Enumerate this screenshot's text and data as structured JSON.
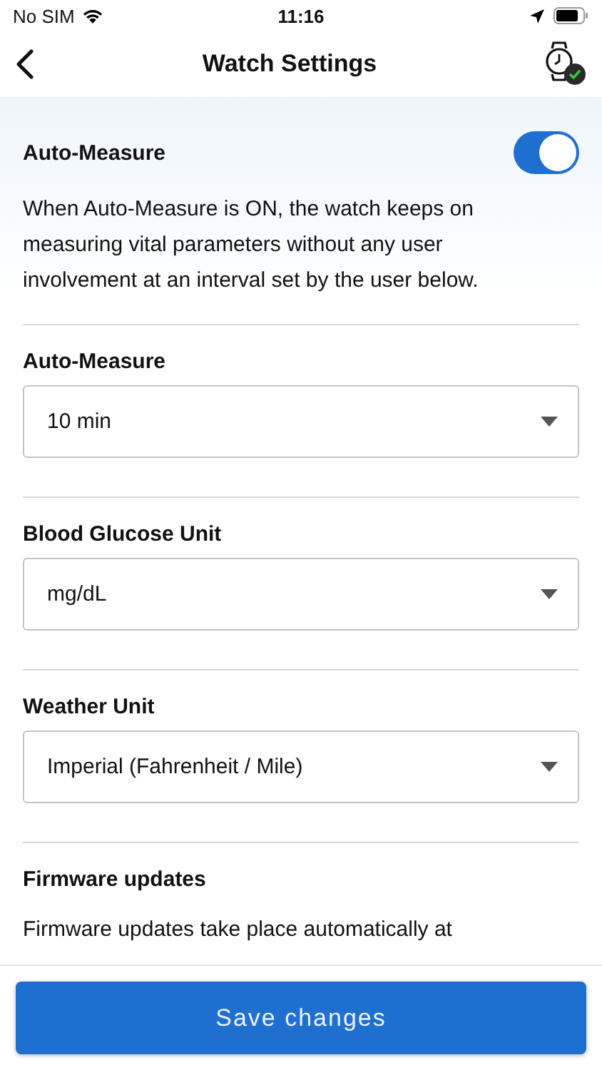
{
  "status_bar": {
    "carrier": "No SIM",
    "time": "11:16"
  },
  "header": {
    "title": "Watch Settings",
    "watch_connected": true
  },
  "sections": [
    {
      "kind": "toggle",
      "title": "Auto-Measure",
      "on": true,
      "description": "When Auto-Measure is ON, the watch keeps on measuring vital parameters without any user involvement at an interval set by the user below."
    },
    {
      "kind": "select",
      "title": "Auto-Measure",
      "value": "10 min"
    },
    {
      "kind": "select",
      "title": "Blood Glucose Unit",
      "value": "mg/dL"
    },
    {
      "kind": "select",
      "title": "Weather Unit",
      "value": "Imperial (Fahrenheit / Mile)"
    },
    {
      "kind": "info",
      "title": "Firmware updates",
      "description": "Firmware updates take place automatically at"
    }
  ],
  "save_button": {
    "label": "Save changes"
  }
}
